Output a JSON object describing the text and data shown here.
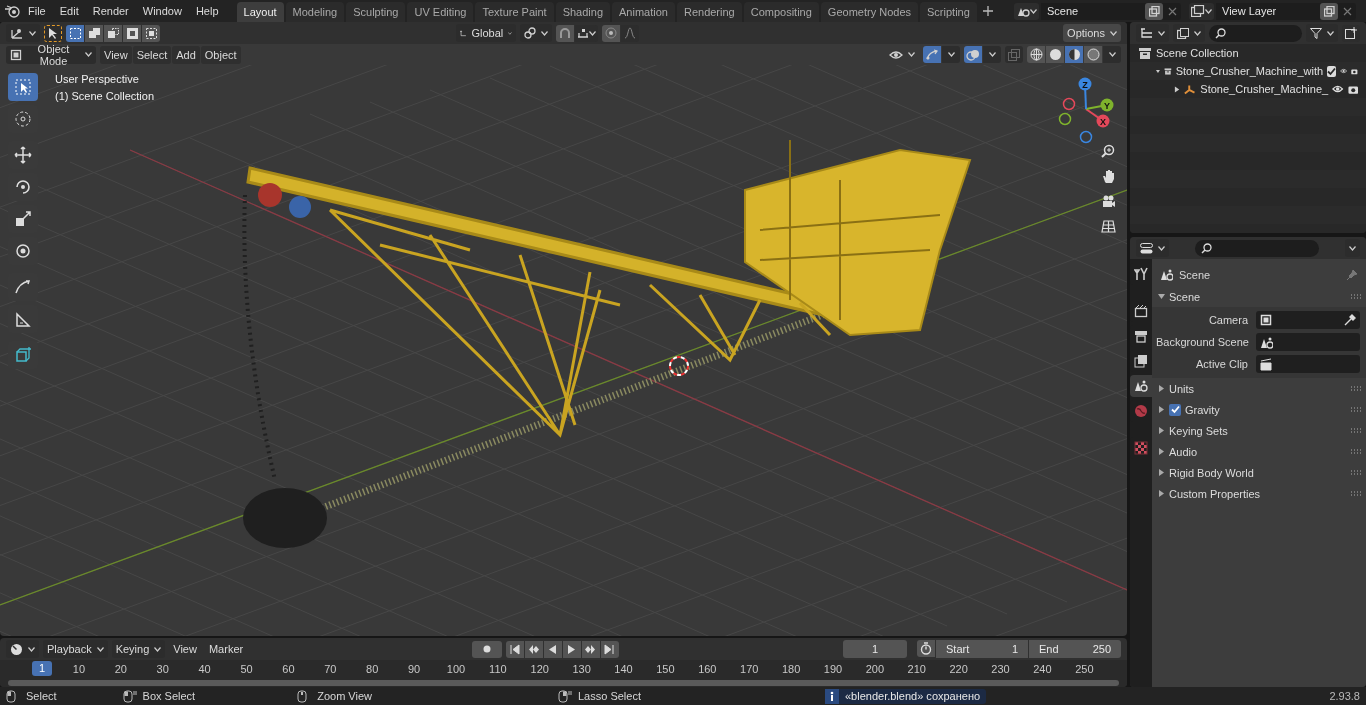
{
  "top_bar": {
    "menus": [
      "File",
      "Edit",
      "Render",
      "Window",
      "Help"
    ],
    "workspaces": [
      {
        "label": "Layout",
        "selected": true
      },
      {
        "label": "Modeling",
        "selected": false
      },
      {
        "label": "Sculpting",
        "selected": false
      },
      {
        "label": "UV Editing",
        "selected": false
      },
      {
        "label": "Texture Paint",
        "selected": false
      },
      {
        "label": "Shading",
        "selected": false
      },
      {
        "label": "Animation",
        "selected": false
      },
      {
        "label": "Rendering",
        "selected": false
      },
      {
        "label": "Compositing",
        "selected": false
      },
      {
        "label": "Geometry Nodes",
        "selected": false
      },
      {
        "label": "Scripting",
        "selected": false
      }
    ],
    "scene": "Scene",
    "view_layer": "View Layer"
  },
  "tool_header": {
    "select_modes": [
      {
        "selected": true
      },
      {
        "selected": false
      },
      {
        "selected": false
      },
      {
        "selected": false
      },
      {
        "selected": false
      }
    ],
    "orientation": "Global",
    "options": "Options"
  },
  "viewport_header": {
    "mode": "Object Mode",
    "menus": [
      "View",
      "Select",
      "Add",
      "Object"
    ],
    "gizmos": {
      "on": true
    },
    "overlays": {
      "on": true
    },
    "xray": {
      "on": false
    },
    "shading": [
      {
        "selected": false
      },
      {
        "selected": false
      },
      {
        "selected": true
      },
      {
        "selected": false
      }
    ]
  },
  "viewport": {
    "info": [
      "User Perspective",
      "(1) Scene Collection"
    ],
    "tools": [
      {
        "selected": true
      },
      {
        "selected": false
      },
      {
        "selected": false
      },
      {
        "selected": false
      },
      {
        "selected": false
      },
      {
        "selected": false
      },
      {
        "selected": false
      },
      {
        "selected": false
      },
      {
        "selected": false
      }
    ],
    "axes": [
      {
        "label": "X",
        "color": "#e4485a"
      },
      {
        "label": "Y",
        "color": "#7fb32c"
      },
      {
        "label": "Z",
        "color": "#3a86e0"
      }
    ]
  },
  "outliner": {
    "items": [
      {
        "label": "Scene Collection",
        "children": [
          {
            "label": "Stone_Crusher_Machine_with",
            "expanded": true,
            "checked": true,
            "children": [
              {
                "label": "Stone_Crusher_Machine_",
                "expanded": false
              }
            ]
          }
        ]
      }
    ]
  },
  "properties": {
    "tabs": [
      {
        "selected": false
      },
      {
        "selected": false
      },
      {
        "selected": false
      },
      {
        "selected": false
      },
      {
        "selected": true
      },
      {
        "selected": false
      },
      {
        "selected": false
      }
    ],
    "context": "Scene",
    "panels": [
      {
        "label": "Scene",
        "expanded": true,
        "fields": [
          {
            "label": "Camera"
          },
          {
            "label": "Background Scene"
          },
          {
            "label": "Active Clip"
          }
        ]
      },
      {
        "label": "Units",
        "expanded": false
      },
      {
        "label": "Gravity",
        "expanded": false,
        "checkbox": {
          "checked": true
        }
      },
      {
        "label": "Keying Sets",
        "expanded": false
      },
      {
        "label": "Audio",
        "expanded": false
      },
      {
        "label": "Rigid Body World",
        "expanded": false
      },
      {
        "label": "Custom Properties",
        "expanded": false
      }
    ]
  },
  "timeline": {
    "menus": [
      "Playback",
      "Keying",
      "View",
      "Marker"
    ],
    "frame": "1",
    "start_label": "Start",
    "start": "1",
    "end_label": "End",
    "end": "250",
    "playhead": "1",
    "ruler": [
      "10",
      "20",
      "30",
      "40",
      "50",
      "60",
      "70",
      "80",
      "90",
      "100",
      "110",
      "120",
      "130",
      "140",
      "150",
      "160",
      "170",
      "180",
      "190",
      "200",
      "210",
      "220",
      "230",
      "240",
      "250"
    ]
  },
  "status_bar": {
    "hints": [
      "Select",
      "Box Select",
      "Zoom View",
      "Lasso Select"
    ],
    "message": "«blender.blend» сохранено",
    "version": "2.93.8"
  }
}
